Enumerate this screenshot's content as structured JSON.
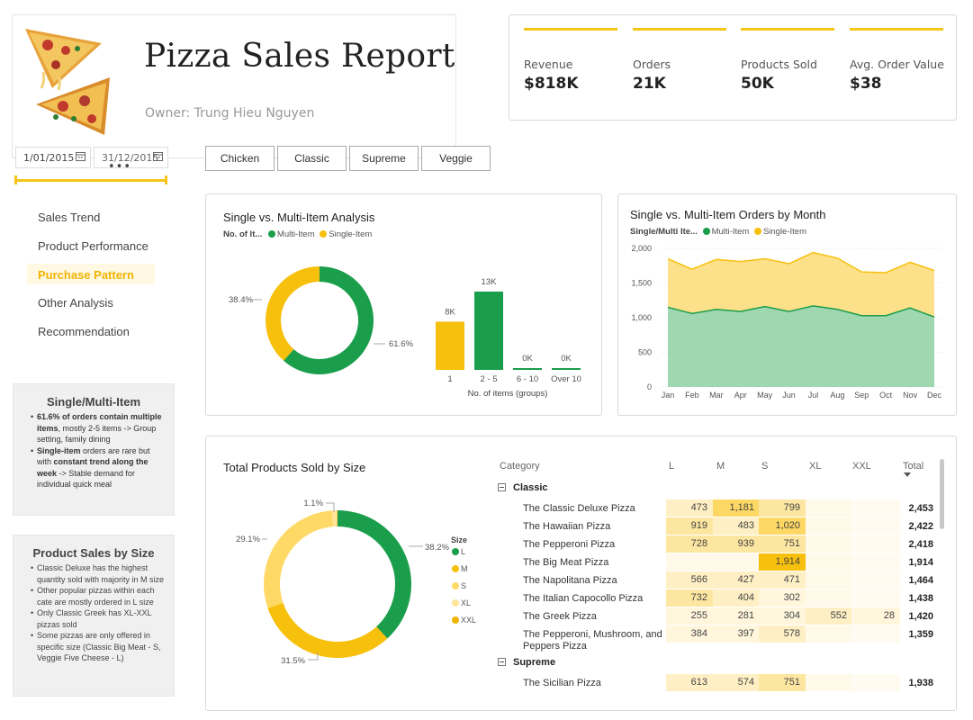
{
  "header": {
    "title": "Pizza Sales Report",
    "owner": "Owner: Trung Hieu Nguyen"
  },
  "kpis": [
    {
      "label": "Revenue",
      "value": "$818K"
    },
    {
      "label": "Orders",
      "value": "21K"
    },
    {
      "label": "Products Sold",
      "value": "50K"
    },
    {
      "label": "Avg. Order Value",
      "value": "$38"
    }
  ],
  "date_slicer": {
    "start": "1/01/2015",
    "end": "31/12/2015",
    "more": "•••"
  },
  "category_buttons": [
    "Chicken",
    "Classic",
    "Supreme",
    "Veggie"
  ],
  "nav": {
    "items": [
      "Sales Trend",
      "Product Performance",
      "Purchase Pattern",
      "Other Analysis",
      "Recommendation"
    ],
    "active": "Purchase Pattern"
  },
  "notes": {
    "single_multi": {
      "title": "Single/Multi-Item",
      "bullet1_bold": "61.6% of orders contain multiple items",
      "bullet1_rest": ", mostly 2-5 items -> Group setting, family dining",
      "bullet2_bold1": "Single-item",
      "bullet2_mid": " orders are rare but with ",
      "bullet2_bold2": "constant trend along the week",
      "bullet2_rest": " -> Stable demand for individual quick meal"
    },
    "size": {
      "title": "Product Sales by Size",
      "bullets": [
        "Classic Deluxe has the highest quantity sold with majority in M size",
        "Other popular pizzas within each cate are mostly ordered in L size",
        "Only Classic Greek has XL-XXL pizzas sold",
        "Some pizzas are only offered in specific size (Classic Big Meat - S, Veggie Five Cheese - L)"
      ]
    }
  },
  "colors": {
    "multi": "#1a9e4b",
    "single": "#f7c00c",
    "accent": "#f5c518",
    "M": "#f7c00c",
    "S": "#ffd966",
    "XL": "#ffe699",
    "XXL": "#f0b400"
  },
  "chart_data": [
    {
      "type": "pie",
      "title": "Single vs. Multi-Item Analysis",
      "legend_title": "No. of It...",
      "series": [
        {
          "name": "Multi-Item",
          "value": 61.6
        },
        {
          "name": "Single-Item",
          "value": 38.4
        }
      ],
      "labels": [
        "61.6%",
        "38.4%"
      ]
    },
    {
      "type": "bar",
      "xlabel": "No. of items (groups)",
      "categories": [
        "1",
        "2 - 5",
        "6 - 10",
        "Over 10"
      ],
      "values": [
        8000,
        13000,
        0,
        0
      ],
      "data_labels": [
        "8K",
        "13K",
        "0K",
        "0K"
      ],
      "colors": [
        "single",
        "multi",
        "multi",
        "multi"
      ],
      "ylim": [
        0,
        13000
      ]
    },
    {
      "type": "area",
      "title": "Single vs. Multi-Item Orders by Month",
      "legend_title": "Single/Multi Ite...",
      "x": [
        "Jan",
        "Feb",
        "Mar",
        "Apr",
        "May",
        "Jun",
        "Jul",
        "Aug",
        "Sep",
        "Oct",
        "Nov",
        "Dec"
      ],
      "series": [
        {
          "name": "Multi-Item",
          "values": [
            1150,
            1060,
            1120,
            1090,
            1160,
            1090,
            1170,
            1120,
            1030,
            1030,
            1140,
            1010
          ]
        },
        {
          "name": "Single-Item",
          "values": [
            700,
            640,
            720,
            720,
            690,
            690,
            770,
            740,
            630,
            620,
            660,
            670
          ]
        }
      ],
      "ylim": [
        0,
        2000
      ],
      "yticks": [
        "0",
        "500",
        "1,000",
        "1,500",
        "2,000"
      ]
    },
    {
      "type": "pie",
      "title": "Total Products Sold by Size",
      "legend_title": "Size",
      "series": [
        {
          "name": "L",
          "value": 38.2
        },
        {
          "name": "M",
          "value": 31.5
        },
        {
          "name": "S",
          "value": 29.1
        },
        {
          "name": "XL",
          "value": 1.1
        },
        {
          "name": "XXL",
          "value": 0.1
        }
      ],
      "labels": [
        "38.2%",
        "31.5%",
        "29.1%",
        "1.1%"
      ]
    },
    {
      "type": "table",
      "columns": [
        "Category",
        "L",
        "M",
        "S",
        "XL",
        "XXL",
        "Total"
      ],
      "groups": [
        {
          "name": "Classic",
          "rows": [
            {
              "name": "The Classic Deluxe Pizza",
              "L": "473",
              "M": "1,181",
              "S": "799",
              "XL": "",
              "XXL": "",
              "total": "2,453"
            },
            {
              "name": "The Hawaiian Pizza",
              "L": "919",
              "M": "483",
              "S": "1,020",
              "XL": "",
              "XXL": "",
              "total": "2,422"
            },
            {
              "name": "The Pepperoni Pizza",
              "L": "728",
              "M": "939",
              "S": "751",
              "XL": "",
              "XXL": "",
              "total": "2,418"
            },
            {
              "name": "The Big Meat Pizza",
              "L": "",
              "M": "",
              "S": "1,914",
              "XL": "",
              "XXL": "",
              "total": "1,914"
            },
            {
              "name": "The Napolitana Pizza",
              "L": "566",
              "M": "427",
              "S": "471",
              "XL": "",
              "XXL": "",
              "total": "1,464"
            },
            {
              "name": "The Italian Capocollo Pizza",
              "L": "732",
              "M": "404",
              "S": "302",
              "XL": "",
              "XXL": "",
              "total": "1,438"
            },
            {
              "name": "The Greek Pizza",
              "L": "255",
              "M": "281",
              "S": "304",
              "XL": "552",
              "XXL": "28",
              "total": "1,420"
            },
            {
              "name": "The Pepperoni, Mushroom, and Peppers Pizza",
              "L": "384",
              "M": "397",
              "S": "578",
              "XL": "",
              "XXL": "",
              "total": "1,359"
            }
          ]
        },
        {
          "name": "Supreme",
          "rows": [
            {
              "name": "The Sicilian Pizza",
              "L": "613",
              "M": "574",
              "S": "751",
              "XL": "",
              "XXL": "",
              "total": "1,938"
            }
          ]
        }
      ]
    }
  ]
}
